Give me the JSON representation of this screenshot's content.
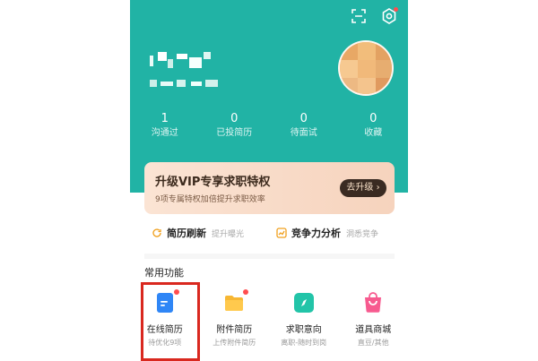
{
  "header": {
    "scan_icon": "scan-icon",
    "settings_icon": "settings-icon"
  },
  "stats": [
    {
      "value": "1",
      "label": "沟通过"
    },
    {
      "value": "0",
      "label": "已投简历"
    },
    {
      "value": "0",
      "label": "待面试"
    },
    {
      "value": "0",
      "label": "收藏"
    }
  ],
  "vip": {
    "title": "升级VIP专享求职特权",
    "subtitle": "9项专属特权加倍提升求职效率",
    "button": "去升级 ›"
  },
  "features": [
    {
      "title": "简历刷新",
      "subtitle": "提升曝光",
      "icon": "refresh-icon"
    },
    {
      "title": "竞争力分析",
      "subtitle": "洞悉竞争",
      "icon": "chart-icon"
    }
  ],
  "common_section": {
    "title": "常用功能"
  },
  "tools": [
    {
      "label": "在线简历",
      "sub": "待优化9项",
      "icon": "resume-icon",
      "badge": true
    },
    {
      "label": "附件简历",
      "sub": "上传附件简历",
      "icon": "folder-icon",
      "badge": true
    },
    {
      "label": "求职意向",
      "sub": "离职-随时到岗",
      "icon": "compass-icon",
      "badge": false
    },
    {
      "label": "道具商城",
      "sub": "直豆/其他",
      "icon": "shop-bag-icon",
      "badge": false
    }
  ],
  "colors": {
    "header_bg": "#21b3a5",
    "highlight": "#d9281f",
    "badge": "#ff4d4f"
  }
}
